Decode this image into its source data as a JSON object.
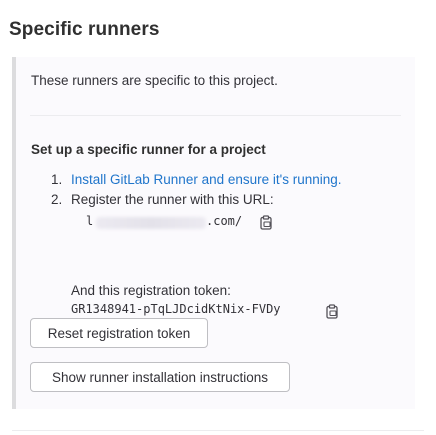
{
  "section": {
    "title": "Specific runners",
    "description": "These runners are specific to this project."
  },
  "setup": {
    "title": "Set up a specific runner for a project",
    "steps": [
      {
        "number": "1.",
        "text": "Install GitLab Runner and ensure it's running."
      },
      {
        "number": "2.",
        "text": "Register the runner with this URL:"
      }
    ],
    "url_prefix": "l",
    "url_suffix": ".com/",
    "token_label": "And this registration token:",
    "token_value": "GR1348941-pTqLJDcidKtNix-FVDy"
  },
  "buttons": {
    "reset_label": "Reset registration token",
    "show_instructions_label": "Show runner installation instructions"
  },
  "icons": {
    "copy_url": "clipboard-icon",
    "copy_token": "clipboard-icon"
  },
  "colors": {
    "link": "#1f75cb",
    "panel_bg": "#fbfafd",
    "panel_border": "#dcdcde"
  }
}
